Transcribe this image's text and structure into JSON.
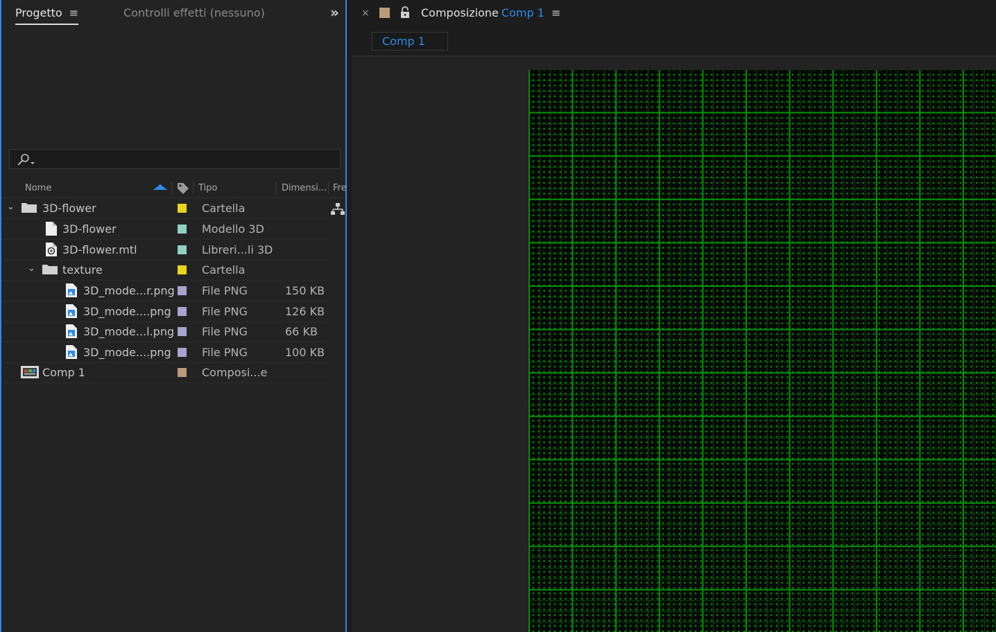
{
  "project_panel": {
    "tabs": [
      {
        "label": "Progetto",
        "active": true
      },
      {
        "label": "Controlli effetti (nessuno)",
        "active": false
      }
    ],
    "menu_glyph": "≡",
    "overflow_glyph": "»",
    "search": {
      "value": "",
      "placeholder": ""
    },
    "columns": [
      {
        "label": "Nome",
        "sorted": "ascending"
      },
      {
        "label": "Tipo"
      },
      {
        "label": "Dimensi..."
      },
      {
        "label": "Fre"
      }
    ],
    "items": [
      {
        "name": "3D-flower",
        "kind": "folder",
        "expanded": true,
        "label_color": "#e8d51c",
        "type": "Cartella",
        "size": ""
      },
      {
        "name": "3D-flower",
        "kind": "file",
        "label_color": "#8fd1c2",
        "type": "Modello 3D",
        "size": ""
      },
      {
        "name": "3D-flower.mtl",
        "kind": "mtl",
        "label_color": "#8fd1c2",
        "type": "Libreri...li 3D",
        "size": ""
      },
      {
        "name": "texture",
        "kind": "folder",
        "expanded": true,
        "label_color": "#e8d51c",
        "type": "Cartella",
        "size": ""
      },
      {
        "name": "3D_mode...r.png",
        "kind": "png",
        "label_color": "#a9a3d2",
        "type": "File PNG",
        "size": "150 KB"
      },
      {
        "name": "3D_mode....png",
        "kind": "png",
        "label_color": "#a9a3d2",
        "type": "File PNG",
        "size": "126 KB"
      },
      {
        "name": "3D_mode...l.png",
        "kind": "png",
        "label_color": "#a9a3d2",
        "type": "File PNG",
        "size": "66 KB"
      },
      {
        "name": "3D_mode....png",
        "kind": "png",
        "label_color": "#a9a3d2",
        "type": "File PNG",
        "size": "100 KB"
      },
      {
        "name": "Comp 1",
        "kind": "comp",
        "label_color": "#b89c78",
        "type": "Composi...e",
        "size": ""
      }
    ]
  },
  "composition_panel": {
    "close_glyph": "×",
    "color": "#b89c78",
    "title_prefix": "Composizione",
    "title_name": "Comp 1",
    "menu_glyph": "≡",
    "subtab": "Comp 1"
  },
  "colors": {
    "accent": "#2d8ceb",
    "grid": "#009600"
  }
}
